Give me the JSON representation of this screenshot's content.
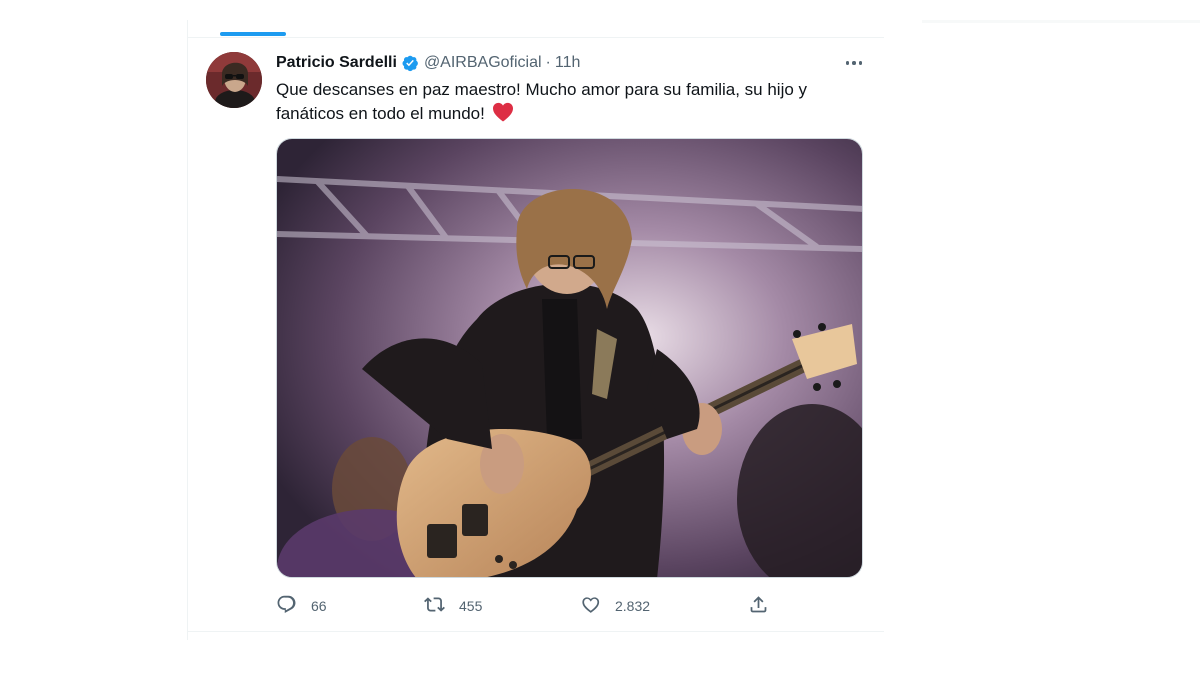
{
  "tweet": {
    "display_name": "Patricio Sardelli",
    "handle": "@AIRBAGoficial",
    "separator": "·",
    "time": "11h",
    "text": "Que descanses en paz maestro!  Mucho amor para su familia, su hijo y fanáticos en todo el mundo!",
    "verified_badge_color": "#1d9bf0",
    "heart_emoji_color": "#e0245e"
  },
  "actions": {
    "replies": "66",
    "retweets": "455",
    "likes": "2.832"
  },
  "colors": {
    "accent": "#1d9bf0",
    "secondary_text": "#536471",
    "primary_text": "#0f1419"
  },
  "icons": {
    "avatar": "avatar",
    "verified": "verified-badge-icon",
    "more": "more-options-icon",
    "reply": "reply-icon",
    "retweet": "retweet-icon",
    "like": "like-icon",
    "share": "share-icon"
  }
}
